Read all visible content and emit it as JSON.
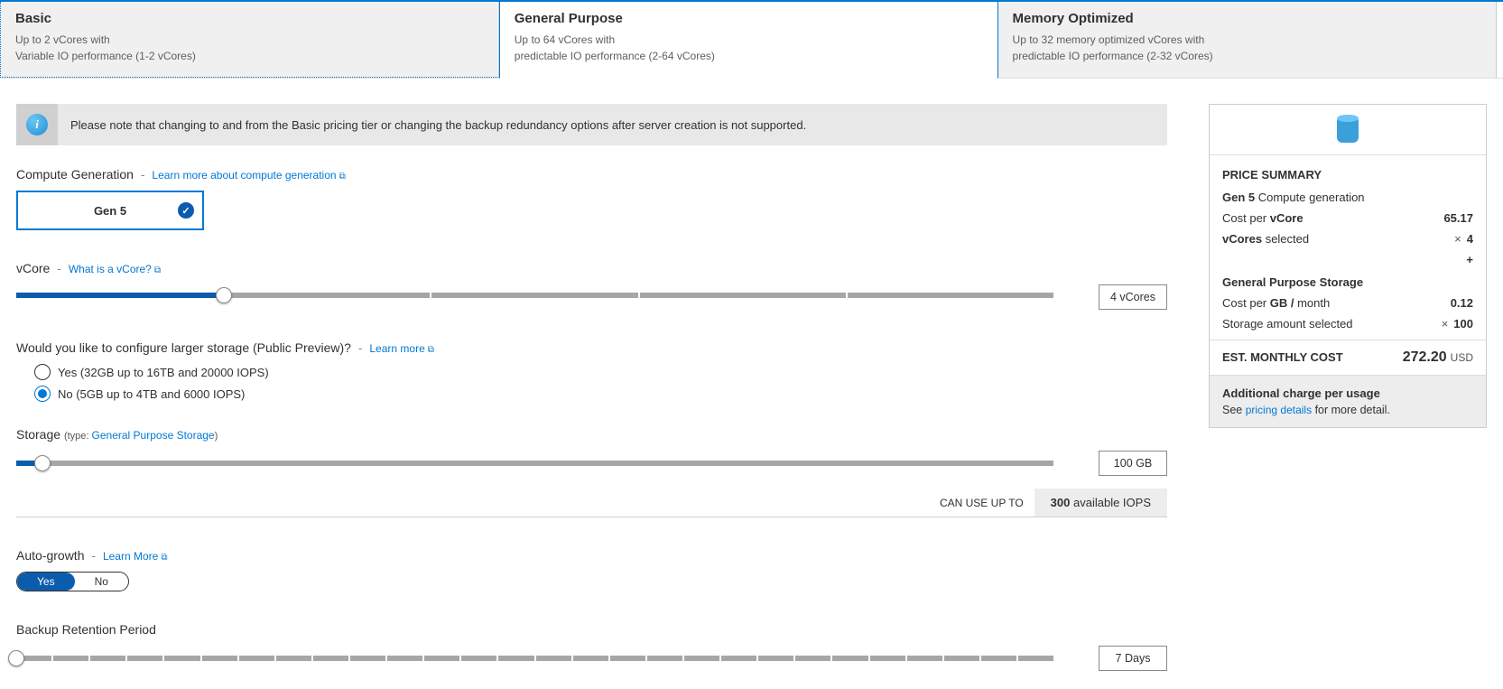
{
  "tiers": [
    {
      "title": "Basic",
      "line1": "Up to 2 vCores with",
      "line2": "Variable IO performance (1-2 vCores)"
    },
    {
      "title": "General Purpose",
      "line1": "Up to 64 vCores with",
      "line2": "predictable IO performance (2-64 vCores)"
    },
    {
      "title": "Memory Optimized",
      "line1": "Up to 32 memory optimized vCores with",
      "line2": "predictable IO performance (2-32 vCores)"
    }
  ],
  "info_text": "Please note that changing to and from the Basic pricing tier or changing the backup redundancy options after server creation is not supported.",
  "compute_gen": {
    "label": "Compute Generation",
    "link": "Learn more about compute generation",
    "option": "Gen 5"
  },
  "vcore": {
    "label": "vCore",
    "link": "What is a vCore?",
    "value": "4 vCores"
  },
  "larger_storage": {
    "label": "Would you like to configure larger storage (Public Preview)?",
    "link": "Learn more",
    "opt_yes": "Yes (32GB up to 16TB and 20000 IOPS)",
    "opt_no": "No (5GB up to 4TB and 6000 IOPS)"
  },
  "storage": {
    "label": "Storage",
    "type_prefix": "(type:",
    "type_link": "General Purpose Storage",
    "type_suffix": ")",
    "value": "100 GB",
    "iops_prefix": "CAN USE UP TO",
    "iops_count": "300",
    "iops_suffix": "available IOPS"
  },
  "autogrowth": {
    "label": "Auto-growth",
    "link": "Learn More",
    "yes": "Yes",
    "no": "No"
  },
  "retention": {
    "label": "Backup Retention Period",
    "value": "7 Days"
  },
  "summary": {
    "title": "PRICE SUMMARY",
    "row1_lab_b": "Gen 5",
    "row1_lab_r": " Compute generation",
    "row2_lab_p": "Cost per ",
    "row2_lab_b": "vCore",
    "row2_val": "65.17",
    "row3_lab_b": "vCores",
    "row3_lab_r": " selected",
    "row3_mult": "×",
    "row3_val": "4",
    "plus": "+",
    "sec2_head": "General Purpose Storage",
    "row4_lab_p": "Cost per ",
    "row4_lab_b": "GB /",
    "row4_lab_r": " month",
    "row4_val": "0.12",
    "row5_lab": "Storage amount selected",
    "row5_mult": "×",
    "row5_val": "100",
    "est_lab": "EST. MONTHLY COST",
    "est_val": "272.20",
    "est_cur": "USD",
    "addl_title": "Additional charge per usage",
    "addl_pre": "See ",
    "addl_link": "pricing details",
    "addl_post": " for more detail."
  }
}
